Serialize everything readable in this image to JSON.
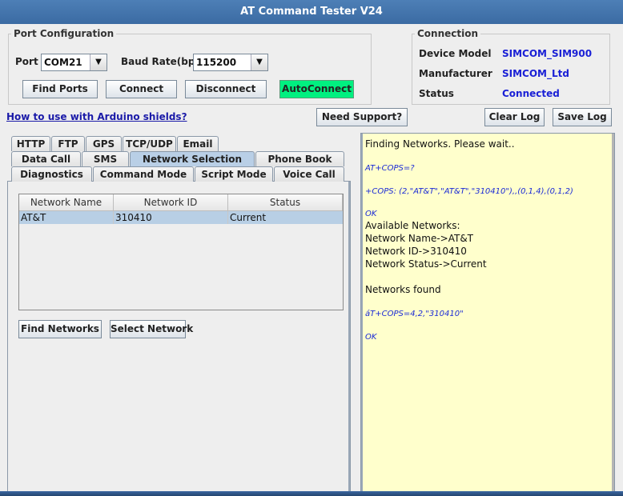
{
  "window": {
    "title": "AT Command Tester V24"
  },
  "port_config": {
    "title": "Port Configuration",
    "port_label": "Port",
    "port_value": "COM21",
    "baud_label": "Baud Rate(bps)",
    "baud_value": "115200",
    "buttons": {
      "find_ports": "Find Ports",
      "connect": "Connect",
      "disconnect": "Disconnect",
      "autoconnect": "AutoConnect"
    }
  },
  "connection": {
    "title": "Connection",
    "device_model_label": "Device Model",
    "device_model_value": "SIMCOM_SIM900",
    "manufacturer_label": "Manufacturer",
    "manufacturer_value": "SIMCOM_Ltd",
    "status_label": "Status",
    "status_value": "Connected"
  },
  "links": {
    "arduino": "How to use with Arduino shields?"
  },
  "toolbar": {
    "need_support": "Need Support?",
    "clear_log": "Clear Log",
    "save_log": "Save Log"
  },
  "tabs": {
    "row1": [
      "HTTP",
      "FTP",
      "GPS",
      "TCP/UDP",
      "Email"
    ],
    "row2": [
      "Data Call",
      "SMS",
      "Network Selection",
      "Phone Book"
    ],
    "row3": [
      "Diagnostics",
      "Command Mode",
      "Script Mode",
      "Voice Call"
    ],
    "selected": "Network Selection"
  },
  "network_table": {
    "columns": [
      "Network Name",
      "Network ID",
      "Status"
    ],
    "rows": [
      [
        "AT&T",
        "310410",
        "Current"
      ]
    ]
  },
  "network_buttons": {
    "find": "Find Networks",
    "select": "Select Network"
  },
  "log": [
    {
      "kind": "text",
      "text": "Finding Networks. Please wait.."
    },
    {
      "kind": "cmd",
      "text": "AT+COPS=?"
    },
    {
      "kind": "cmd",
      "text": "+COPS: (2,\"AT&T\",\"AT&T\",\"310410\"),,(0,1,4),(0,1,2)"
    },
    {
      "kind": "cmd",
      "text": "OK"
    },
    {
      "kind": "text",
      "text": "Available Networks:"
    },
    {
      "kind": "text",
      "text": "Network Name->AT&T"
    },
    {
      "kind": "text",
      "text": "Network ID->310410"
    },
    {
      "kind": "text",
      "text": "Network Status->Current"
    },
    {
      "kind": "text",
      "text": "Networks found"
    },
    {
      "kind": "cmd",
      "text": "áT+COPS=4,2,\"310410\""
    },
    {
      "kind": "cmd",
      "text": "OK"
    }
  ],
  "colors": {
    "title_bar": "#3f70a8",
    "autoconnect": "#00f080",
    "log_bg": "#ffffcc",
    "tab_selected": "#b9cfe6",
    "row_selected": "#b8cfe5",
    "value_blue": "#1a20d6"
  }
}
